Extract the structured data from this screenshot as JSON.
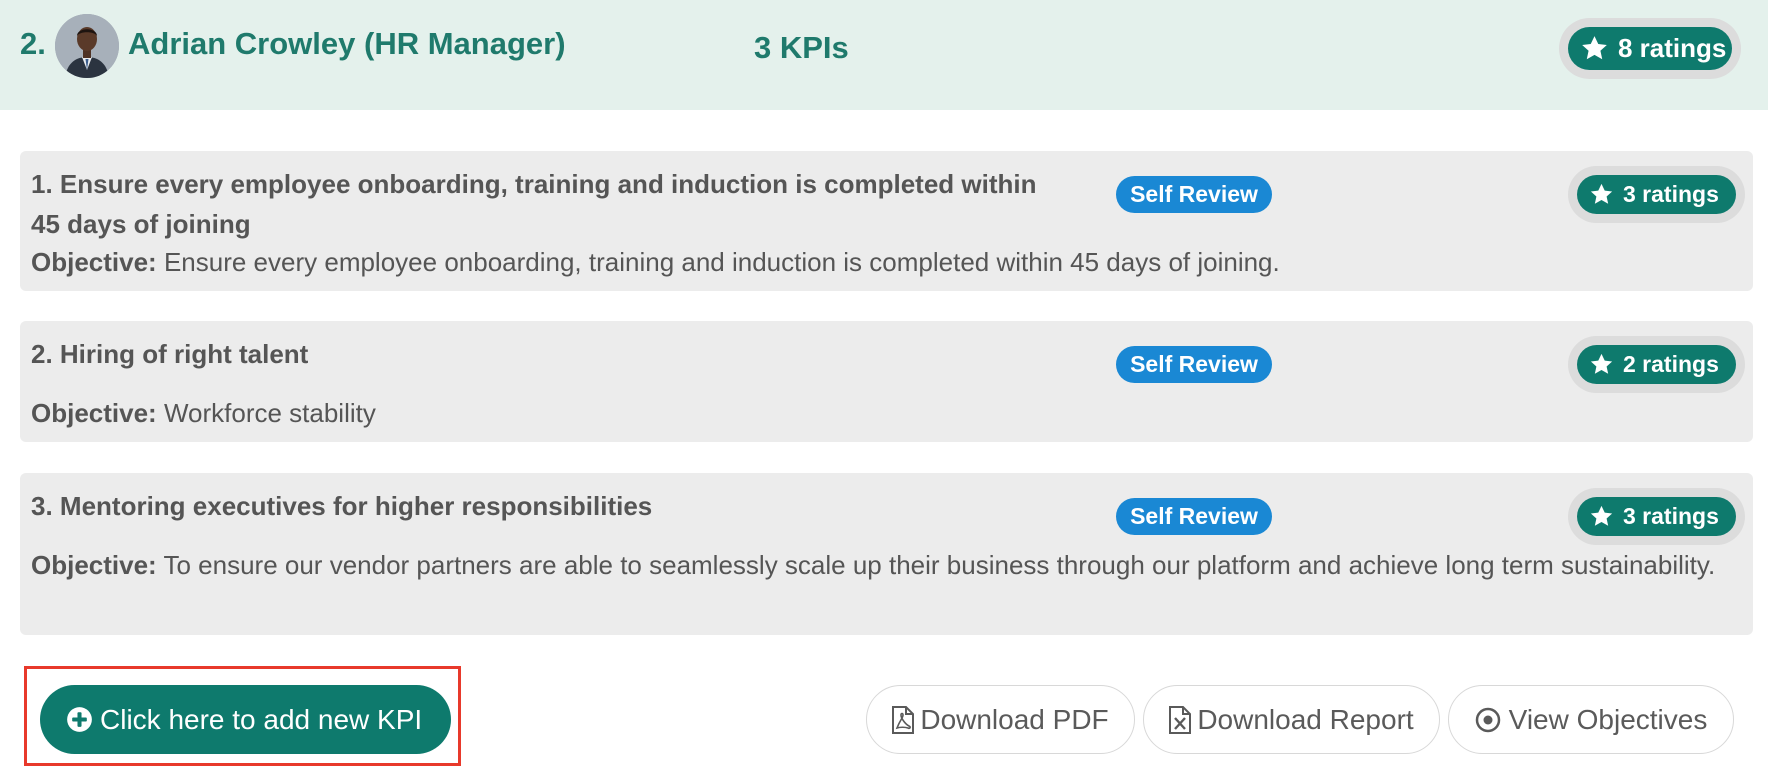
{
  "employee": {
    "number": "2.",
    "name": "Adrian Crowley (HR Manager)",
    "kpi_count": "3 KPIs",
    "ratings": "8 ratings"
  },
  "kpis": [
    {
      "title": "1. Ensure every employee onboarding, training and induction is completed within 45 days of joining",
      "objective_label": "Objective:",
      "objective": "Ensure every employee onboarding, training and induction is completed within 45 days of joining.",
      "review_type": "Self Review",
      "ratings": "3 ratings"
    },
    {
      "title": "2. Hiring of right talent",
      "objective_label": "Objective:",
      "objective": "Workforce stability",
      "review_type": "Self Review",
      "ratings": "2 ratings"
    },
    {
      "title": "3. Mentoring executives for higher responsibilities",
      "objective_label": "Objective:",
      "objective": "To ensure our vendor partners are able to seamlessly scale up their business through our platform and achieve long term sustainability.",
      "review_type": "Self Review",
      "ratings": "3 ratings"
    }
  ],
  "actions": {
    "add_kpi": "Click here to add new KPI",
    "download_pdf": "Download PDF",
    "download_report": "Download Report",
    "view_objectives": "View Objectives"
  },
  "icons": {
    "rating": "star-icon",
    "add": "plus-circle-icon",
    "pdf": "file-pdf-icon",
    "report": "file-excel-icon",
    "objectives": "target-icon"
  },
  "colors": {
    "primary": "#0e7a6d",
    "header_bg": "#e4f1ec",
    "header_text": "#1f7a6c",
    "badge_blue": "#1a88d4",
    "card_bg": "#ececec",
    "highlight_outline": "#e8392b"
  }
}
